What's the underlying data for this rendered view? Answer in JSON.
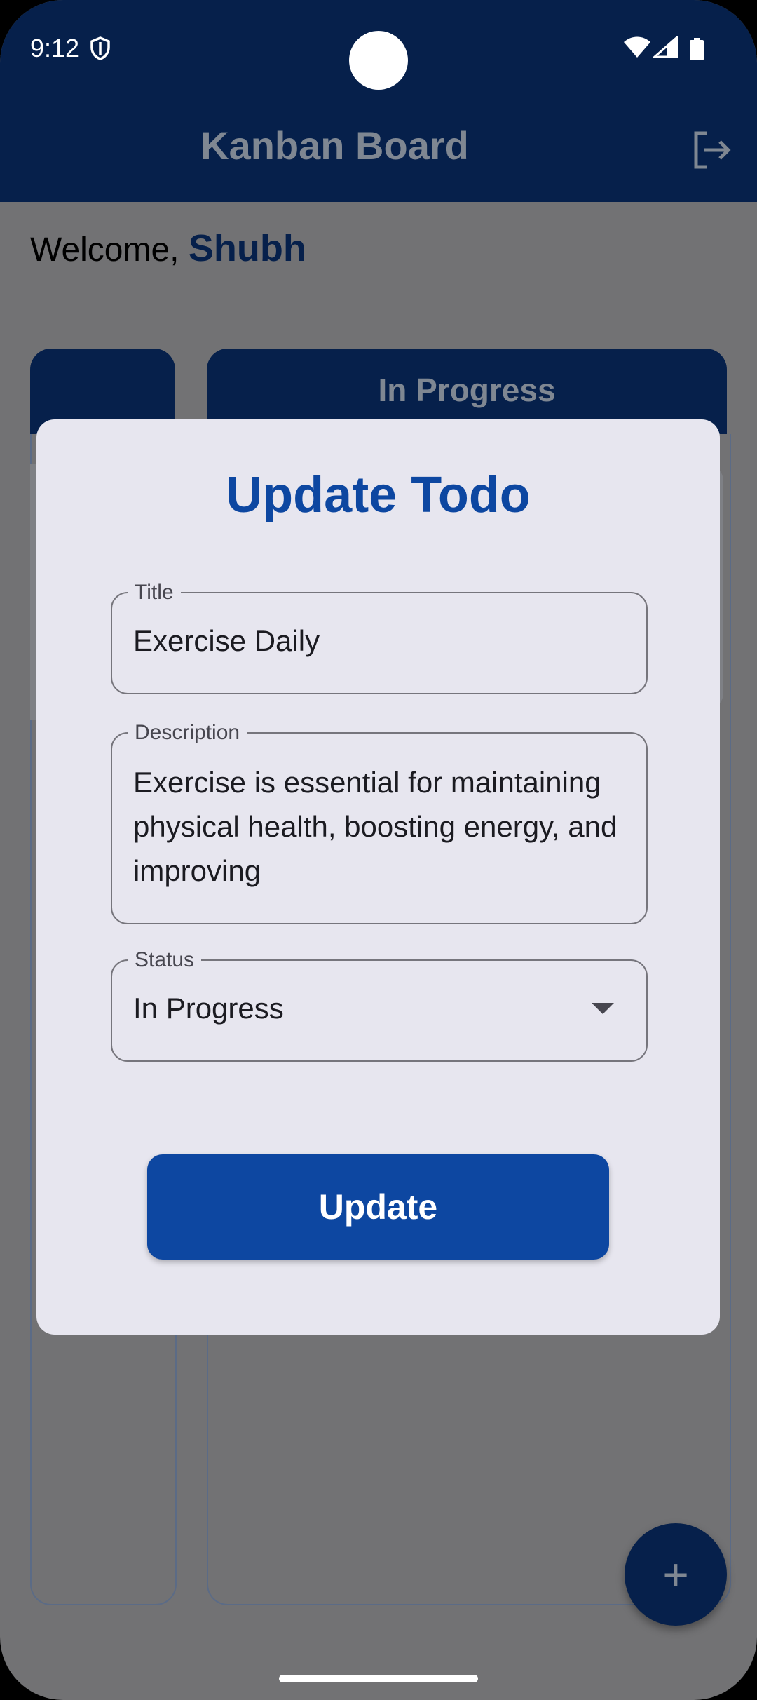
{
  "status_bar": {
    "time": "9:12"
  },
  "app_bar": {
    "title": "Kanban Board"
  },
  "welcome": {
    "prefix": "Welcome,",
    "name": "Shubh"
  },
  "columns": [
    {
      "label": ""
    },
    {
      "label": "In Progress"
    }
  ],
  "dialog": {
    "title": "Update Todo",
    "title_field": {
      "label": "Title",
      "value": "Exercise Daily"
    },
    "description_field": {
      "label": "Description",
      "value": "Exercise is essential for maintaining physical health, boosting energy, and improving"
    },
    "status_field": {
      "label": "Status",
      "value": "In Progress"
    },
    "submit_label": "Update"
  },
  "fab": {
    "symbol": "+"
  },
  "colors": {
    "primary": "#0d47a1",
    "app_bar": "#06204b",
    "dialog_bg": "#e7e6ef",
    "scrim": "#727274"
  }
}
